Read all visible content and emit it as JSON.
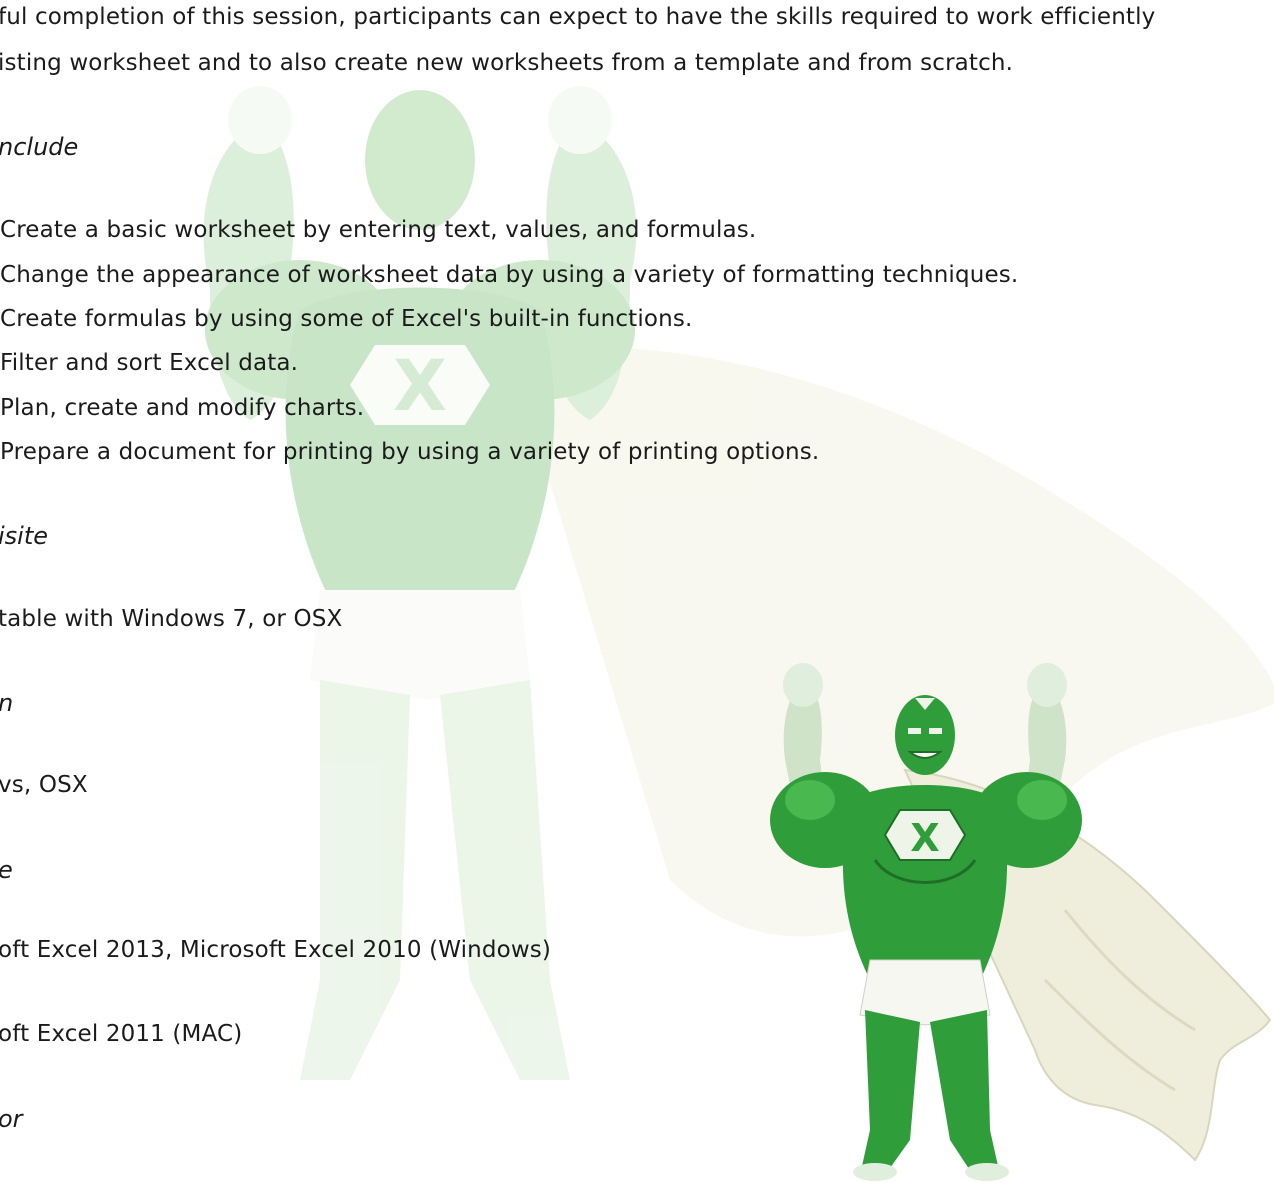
{
  "intro": {
    "line1": "ful completion of this session, participants can expect to have the skills required to work efficiently",
    "line2": "isting worksheet and to also create new worksheets from a template and from scratch."
  },
  "objectives": {
    "heading": "nclude",
    "items": [
      "Create a basic worksheet by entering text, values, and formulas.",
      "Change the appearance of worksheet data by using a variety of formatting techniques.",
      "Create formulas by using some of Excel's built-in functions.",
      "Filter and sort Excel data.",
      "Plan, create and modify charts.",
      "Prepare a document for printing by using a variety of printing options."
    ]
  },
  "prerequisite": {
    "heading": "isite",
    "text": "table with Windows 7, or OSX"
  },
  "platform": {
    "heading": "n",
    "text": "vs, OSX"
  },
  "software": {
    "heading": "e",
    "items": [
      "oft Excel 2013, Microsoft Excel 2010 (Windows)",
      "oft Excel 2011 (MAC)"
    ]
  },
  "instructor": {
    "heading": "or"
  },
  "images": {
    "watermark": "excel-superhero-watermark",
    "mascot": "excel-superhero-mascot"
  },
  "colors": {
    "hero_green": "#2f9e3a",
    "hero_dark_green": "#1f6e28",
    "cape": "#efeedd",
    "text": "#1b1b1b"
  }
}
